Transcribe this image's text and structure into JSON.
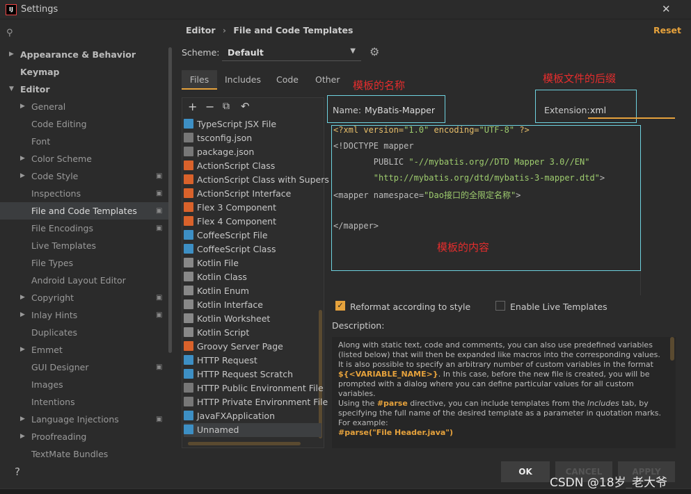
{
  "window": {
    "title": "Settings",
    "close": "✕"
  },
  "search": {
    "icon": "search-icon",
    "placeholder": ""
  },
  "sidebar": {
    "items": [
      {
        "label": "Appearance & Behavior",
        "level": 0,
        "arrow": "▶",
        "bold": true
      },
      {
        "label": "Keymap",
        "level": 0,
        "bold": true
      },
      {
        "label": "Editor",
        "level": 0,
        "arrow": "▼",
        "bold": true
      },
      {
        "label": "General",
        "level": 1,
        "arrow": "▶"
      },
      {
        "label": "Code Editing",
        "level": 1
      },
      {
        "label": "Font",
        "level": 1
      },
      {
        "label": "Color Scheme",
        "level": 1,
        "arrow": "▶"
      },
      {
        "label": "Code Style",
        "level": 1,
        "arrow": "▶",
        "cfg": true
      },
      {
        "label": "Inspections",
        "level": 1,
        "cfg": true
      },
      {
        "label": "File and Code Templates",
        "level": 1,
        "cfg": true,
        "selected": true
      },
      {
        "label": "File Encodings",
        "level": 1,
        "cfg": true
      },
      {
        "label": "Live Templates",
        "level": 1
      },
      {
        "label": "File Types",
        "level": 1
      },
      {
        "label": "Android Layout Editor",
        "level": 1
      },
      {
        "label": "Copyright",
        "level": 1,
        "arrow": "▶",
        "cfg": true
      },
      {
        "label": "Inlay Hints",
        "level": 1,
        "arrow": "▶",
        "cfg": true
      },
      {
        "label": "Duplicates",
        "level": 1
      },
      {
        "label": "Emmet",
        "level": 1,
        "arrow": "▶"
      },
      {
        "label": "GUI Designer",
        "level": 1,
        "cfg": true
      },
      {
        "label": "Images",
        "level": 1
      },
      {
        "label": "Intentions",
        "level": 1
      },
      {
        "label": "Language Injections",
        "level": 1,
        "arrow": "▶",
        "cfg": true
      },
      {
        "label": "Proofreading",
        "level": 1,
        "arrow": "▶"
      },
      {
        "label": "TextMate Bundles",
        "level": 1
      }
    ]
  },
  "breadcrumb": {
    "parent": "Editor",
    "sep": "›",
    "current": "File and Code Templates"
  },
  "reset": "Reset",
  "scheme": {
    "label": "Scheme:",
    "value": "Default"
  },
  "tabs": [
    "Files",
    "Includes",
    "Code",
    "Other"
  ],
  "active_tab": "Files",
  "toolbar": {
    "add": "+",
    "remove": "−",
    "copy": "⧉",
    "reset": "↶"
  },
  "files": [
    {
      "label": "TypeScript JSX File",
      "color": "#3d8fc4"
    },
    {
      "label": "tsconfig.json",
      "color": "#777"
    },
    {
      "label": "package.json",
      "color": "#777"
    },
    {
      "label": "ActionScript Class",
      "color": "#d9622b"
    },
    {
      "label": "ActionScript Class with Supers",
      "color": "#d9622b"
    },
    {
      "label": "ActionScript Interface",
      "color": "#d9622b"
    },
    {
      "label": "Flex 3 Component",
      "color": "#d9622b"
    },
    {
      "label": "Flex 4 Component",
      "color": "#d9622b"
    },
    {
      "label": "CoffeeScript File",
      "color": "#3d8fc4"
    },
    {
      "label": "CoffeeScript Class",
      "color": "#3d8fc4"
    },
    {
      "label": "Kotlin File",
      "color": "#888"
    },
    {
      "label": "Kotlin Class",
      "color": "#888"
    },
    {
      "label": "Kotlin Enum",
      "color": "#888"
    },
    {
      "label": "Kotlin Interface",
      "color": "#888"
    },
    {
      "label": "Kotlin Worksheet",
      "color": "#888"
    },
    {
      "label": "Kotlin Script",
      "color": "#888"
    },
    {
      "label": "Groovy Server Page",
      "color": "#d9622b"
    },
    {
      "label": "HTTP Request",
      "color": "#3d8fc4"
    },
    {
      "label": "HTTP Request Scratch",
      "color": "#3d8fc4"
    },
    {
      "label": "HTTP Public Environment File",
      "color": "#777"
    },
    {
      "label": "HTTP Private Environment File",
      "color": "#777"
    },
    {
      "label": "JavaFXApplication",
      "color": "#3d8fc4"
    },
    {
      "label": "Unnamed",
      "color": "#3d8fc4",
      "selected": true
    }
  ],
  "name": {
    "label": "Name:",
    "value": "MyBatis-Mapper"
  },
  "extension": {
    "label": "Extension:",
    "value": "xml"
  },
  "annotations": {
    "name": "模板的名称",
    "extension": "模板文件的后缀",
    "content": "模板的内容"
  },
  "code": {
    "l1a": "<?xml version=",
    "l1b": "\"1.0\"",
    "l1c": " encoding=",
    "l1d": "\"UTF-8\"",
    "l1e": " ?>",
    "l2": "<!DOCTYPE mapper",
    "l3a": "        PUBLIC ",
    "l3b": "\"-//mybatis.org//DTD Mapper 3.0//EN\"",
    "l4a": "        ",
    "l4b": "\"http://mybatis.org/dtd/mybatis-3-mapper.dtd\"",
    "l4c": ">",
    "l5a": "<mapper namespace=",
    "l5b": "\"Dao接口的全限定名称\"",
    "l5c": ">",
    "l6": "</mapper>"
  },
  "options": {
    "reformat": {
      "label": "Reformat according to style",
      "checked": true
    },
    "live": {
      "label": "Enable Live Templates",
      "checked": false
    }
  },
  "description": {
    "label": "Description:",
    "p1": "Along with static text, code and comments, you can also use predefined variables (listed below) that will then be expanded like macros into the corresponding values.",
    "p2a": "It is also possible to specify an arbitrary number of custom variables in the format ",
    "p2b": "${<VARIABLE_NAME>}",
    "p2c": ". In this case, before the new file is created, you will be prompted with a dialog where you can define particular values for all custom variables.",
    "p3a": "Using the ",
    "p3b": "#parse",
    "p3c": " directive, you can include templates from the ",
    "p3d": "Includes",
    "p3e": " tab, by specifying the full name of the desired template as a parameter in quotation marks. For example:",
    "p4": "#parse(\"File Header.java\")"
  },
  "buttons": {
    "help": "?",
    "ok": "OK",
    "cancel": "CANCEL",
    "apply": "APPLY"
  },
  "watermark": "CSDN @18岁_老大爷",
  "colors": {
    "accent": "#e6a23c",
    "annotation": "#e52d2d",
    "highlight_box": "#6fd3e0"
  }
}
